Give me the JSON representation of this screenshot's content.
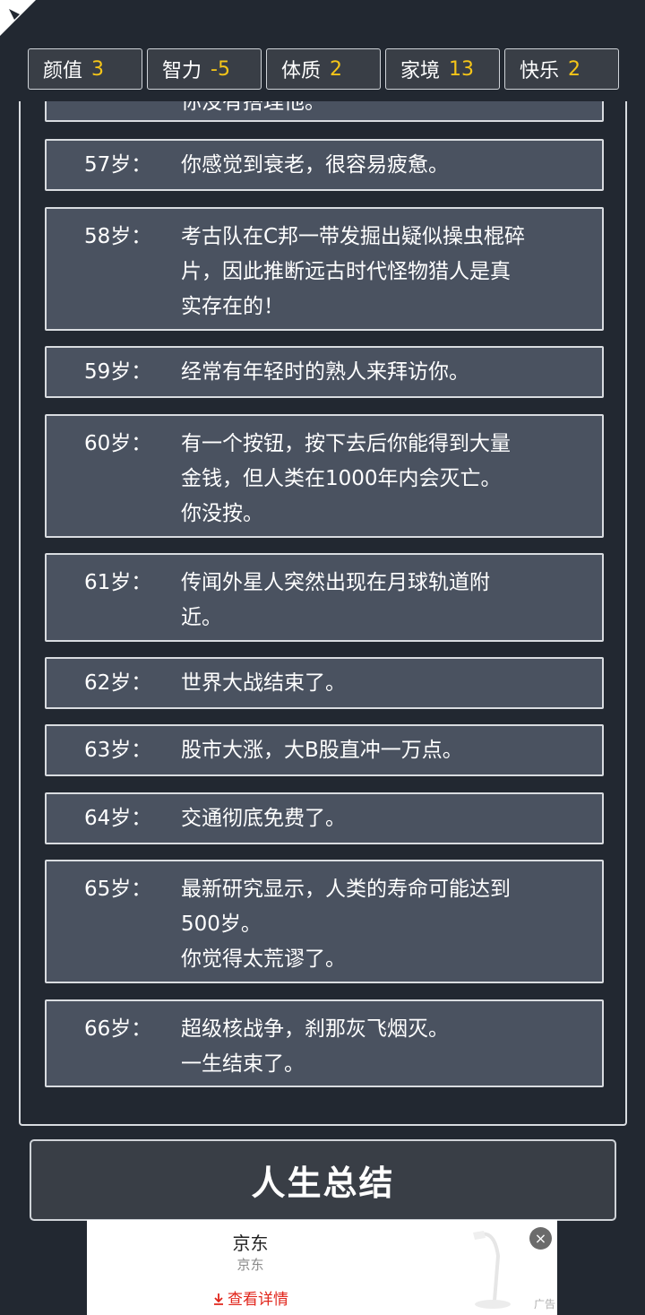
{
  "stats": [
    {
      "label": "颜值",
      "value": "3"
    },
    {
      "label": "智力",
      "value": "-5"
    },
    {
      "label": "体质",
      "value": "2"
    },
    {
      "label": "家境",
      "value": "13"
    },
    {
      "label": "快乐",
      "value": "2"
    }
  ],
  "timeline": {
    "partial_text": "你没有搭理他。",
    "entries": [
      {
        "age": "57岁：",
        "lines": [
          "你感觉到衰老，很容易疲惫。"
        ]
      },
      {
        "age": "58岁：",
        "lines": [
          "考古队在C邦一带发掘出疑似操虫棍碎",
          "片，因此推断远古时代怪物猎人是真",
          "实存在的！"
        ]
      },
      {
        "age": "59岁：",
        "lines": [
          "经常有年轻时的熟人来拜访你。"
        ]
      },
      {
        "age": "60岁：",
        "lines": [
          "有一个按钮，按下去后你能得到大量",
          "金钱，但人类在1000年内会灭亡。",
          "你没按。"
        ]
      },
      {
        "age": "61岁：",
        "lines": [
          "传闻外星人突然出现在月球轨道附",
          "近。"
        ]
      },
      {
        "age": "62岁：",
        "lines": [
          "世界大战结束了。"
        ]
      },
      {
        "age": "63岁：",
        "lines": [
          "股市大涨，大B股直冲一万点。"
        ]
      },
      {
        "age": "64岁：",
        "lines": [
          "交通彻底免费了。"
        ]
      },
      {
        "age": "65岁：",
        "lines": [
          "最新研究显示，人类的寿命可能达到",
          "500岁。",
          "你觉得太荒谬了。"
        ]
      },
      {
        "age": "66岁：",
        "lines": [
          "超级核战争，刹那灰飞烟灭。",
          "一生结束了。"
        ]
      }
    ]
  },
  "summary_button": {
    "label": "人生总结"
  },
  "ad": {
    "title": "京东",
    "subtitle": "京东",
    "cta": "查看详情",
    "tag": "广告",
    "close": "×"
  }
}
